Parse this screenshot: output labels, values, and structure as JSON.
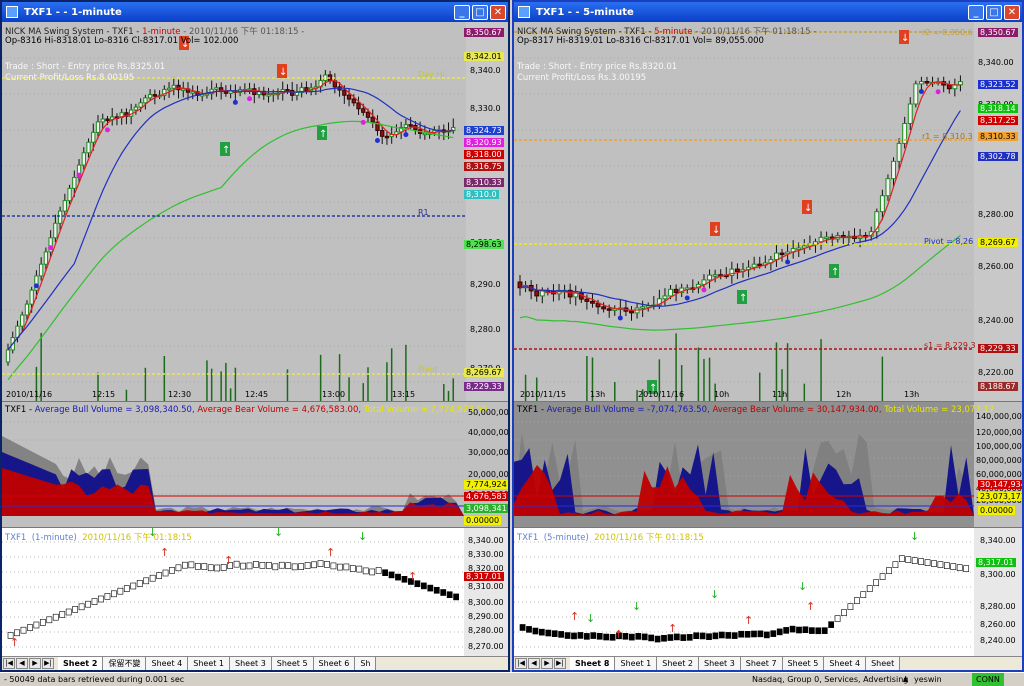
{
  "left": {
    "title": "TXF1  -  -  1-minute",
    "price_header": {
      "system": "NICK MA Swing System - TXF1 - ",
      "interval": "1-minute",
      "datetime": " - 2010/11/16 下午 01:18:15 -",
      "ohlc": "Op-8316  Hi-8318.01  Lo-8316  Cl-8317.01  Vol= 102.000",
      "trade": "Trade : Short - Entry price Rs.8325.01",
      "pnl": "Current Profit/Loss Rs.8.00195"
    },
    "price_axis": [
      "8,340.0",
      "8,330.0",
      "8,300.0",
      "8,290.0",
      "8,280.0",
      "8,270.0"
    ],
    "price_tags": [
      {
        "text": "8,350.67",
        "color": "#8b1b6b"
      },
      {
        "text": "8,342.01",
        "color": "#e8e850"
      },
      {
        "text": "8,324.73",
        "color": "#2040d0"
      },
      {
        "text": "8,320.93",
        "color": "#e020e0"
      },
      {
        "text": "8,318.00",
        "color": "#d00000"
      },
      {
        "text": "8,316.75",
        "color": "#b01010"
      },
      {
        "text": "8,310.33",
        "color": "#7a2a6a"
      },
      {
        "text": "8,310.0",
        "color": "#30c0c0"
      },
      {
        "text": "8,298.63",
        "color": "#50e050"
      },
      {
        "text": "8,269.67",
        "color": "#e8e850"
      },
      {
        "text": "8,229.33",
        "color": "#7a2a8a"
      }
    ],
    "chart_labels": {
      "dayhi": "Day Hi",
      "r1": "R1",
      "pivot": "Pivot"
    },
    "time_axis": [
      "2010/11/16",
      "12:15",
      "12:30",
      "12:45",
      "13:00",
      "13:15"
    ],
    "volume_header": {
      "prefix": "TXF1 - ",
      "bull": "Average Bull Volume = 3,098,340.50, ",
      "bear": "Average Bear Volume = 4,676,583.00, ",
      "total": "Total Volume = 7,774,923.50"
    },
    "volume_axis": [
      "50,000,000",
      "40,000,000",
      "30,000,000",
      "20,000,000",
      "10,000,000"
    ],
    "volume_tags": [
      {
        "text": "7,774,924",
        "color": "#f0f000"
      },
      {
        "text": "4,676,583",
        "color": "#d00000"
      },
      {
        "text": "3,098,341",
        "color": "#2ab02a"
      },
      {
        "text": "0.00000",
        "color": "#f0f000"
      }
    ],
    "kagi_header": {
      "symbol": "TXF1",
      "interval": "(1-minute)",
      "datetime": "2010/11/16 下午 01:18:15"
    },
    "kagi_axis": [
      "8,340.00",
      "8,330.00",
      "8,320.00",
      "8,310.00",
      "8,300.00",
      "8,290.00",
      "8,280.00",
      "8,270.00"
    ],
    "kagi_tag": {
      "text": "8,317.01",
      "color": "#d00000"
    },
    "sheets": [
      "Sheet 2",
      "保留不變",
      "Sheet 4",
      "Sheet 1",
      "Sheet 3",
      "Sheet 5",
      "Sheet 6",
      "Sh"
    ]
  },
  "right": {
    "title": "TXF1  -  -  5-minute",
    "price_header": {
      "system": "NICK MA Swing System - TXF1 - ",
      "interval": "5-minute",
      "datetime": " - 2010/11/16 下午 01:18:15 -",
      "ohlc": "Op-8317  Hi-8319.01  Lo-8316  Cl-8317.01  Vol= 89,055.000",
      "trade": "Trade : Short - Entry price Rs.8320.01",
      "pnl": "Current Profit/Loss Rs.3.00195"
    },
    "price_axis": [
      "8,340.00",
      "8,330.00",
      "8,280.00",
      "8,260.00",
      "8,240.00",
      "8,220.00"
    ],
    "price_tags": [
      {
        "text": "8,350.67",
        "color": "#8b1b6b"
      },
      {
        "text": "8,323.52",
        "color": "#1a30d0"
      },
      {
        "text": "8,318.14",
        "color": "#10c010"
      },
      {
        "text": "8,317.25",
        "color": "#d00000"
      },
      {
        "text": "8,310.33",
        "color": "#f0a030"
      },
      {
        "text": "8,302.78",
        "color": "#2030c0"
      },
      {
        "text": "8,269.67",
        "color": "#f0f000"
      },
      {
        "text": "8,229.33",
        "color": "#b01010"
      },
      {
        "text": "8,188.67",
        "color": "#9a2a2a"
      }
    ],
    "chart_labels": {
      "r2": "r2 = 8,350.6",
      "r1": "r1 = 8,310.3",
      "pivot": "Pivot = 8,26",
      "s1": "s1 = 8,229.3"
    },
    "time_axis": [
      "2010/11/15",
      "13h",
      "2010/11/16",
      "10h",
      "11h",
      "12h",
      "13h"
    ],
    "volume_header": {
      "prefix": "TXF1 - ",
      "bull": "Average Bull Volume = -7,074,763.50, ",
      "bear": "Average Bear Volume = 30,147,934.00, ",
      "total": "Total Volume = 23,073,17"
    },
    "volume_axis": [
      "140,000,000",
      "120,000,000",
      "100,000,000",
      "80,000,000",
      "60,000,000",
      "40,000,000",
      "20,000,000"
    ],
    "volume_tags": [
      {
        "text": "30,147,934",
        "color": "#d00000"
      },
      {
        "text": "23,073,171",
        "color": "#f0f000"
      },
      {
        "text": "0.00000",
        "color": "#f0f000"
      }
    ],
    "kagi_header": {
      "symbol": "TXF1",
      "interval": "(5-minute)",
      "datetime": "2010/11/16 下午 01:18:15"
    },
    "kagi_axis": [
      "8,340.00",
      "8,300.00",
      "8,280.00",
      "8,260.00",
      "8,240.00"
    ],
    "kagi_tag": {
      "text": "8,317.01",
      "color": "#10c010"
    },
    "sheets": [
      "Sheet 8",
      "Sheet 1",
      "Sheet 2",
      "Sheet 3",
      "Sheet 7",
      "Sheet 5",
      "Sheet 4",
      "Sheet"
    ]
  },
  "status": {
    "left": "- 50049 data bars retrieved during 0.001 sec",
    "middle": "Nasdaq, Group 0, Services, Advertising",
    "user": "yeswin",
    "conn": "CONN"
  }
}
